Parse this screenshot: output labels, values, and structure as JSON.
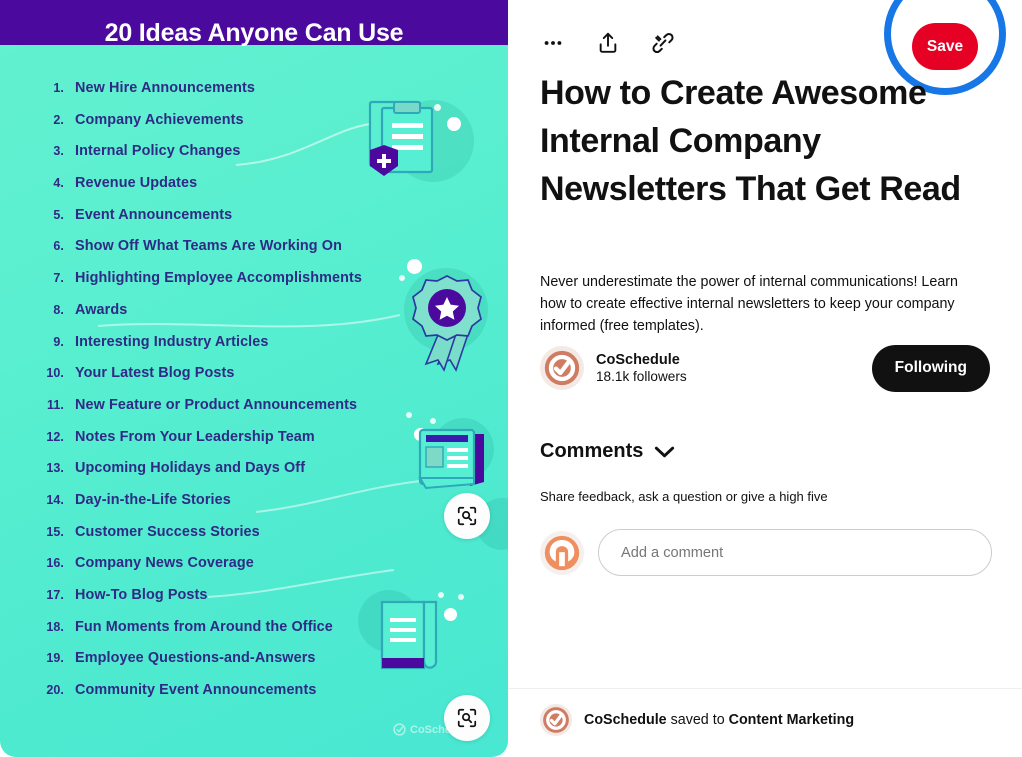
{
  "pin_image": {
    "banner_title": "20 Ideas Anyone Can Use",
    "watermark": "CoSchedule",
    "list": [
      {
        "num": "1.",
        "text": "New Hire Announcements"
      },
      {
        "num": "2.",
        "text": "Company Achievements"
      },
      {
        "num": "3.",
        "text": "Internal Policy Changes"
      },
      {
        "num": "4.",
        "text": "Revenue Updates"
      },
      {
        "num": "5.",
        "text": "Event Announcements"
      },
      {
        "num": "6.",
        "text": "Show Off What Teams Are Working On"
      },
      {
        "num": "7.",
        "text": "Highlighting Employee Accomplishments"
      },
      {
        "num": "8.",
        "text": "Awards"
      },
      {
        "num": "9.",
        "text": "Interesting Industry Articles"
      },
      {
        "num": "10.",
        "text": "Your Latest Blog Posts"
      },
      {
        "num": "11.",
        "text": "New Feature or Product Announcements"
      },
      {
        "num": "12.",
        "text": " Notes From Your Leadership Team"
      },
      {
        "num": "13.",
        "text": "Upcoming Holidays and Days Off"
      },
      {
        "num": "14.",
        "text": "Day-in-the-Life Stories"
      },
      {
        "num": "15.",
        "text": "Customer Success Stories"
      },
      {
        "num": "16.",
        "text": "Company News Coverage"
      },
      {
        "num": "17.",
        "text": "How-To Blog Posts"
      },
      {
        "num": "18.",
        "text": "Fun Moments from Around the Office"
      },
      {
        "num": "19.",
        "text": "Employee Questions-and-Answers"
      },
      {
        "num": "20.",
        "text": "Community Event Announcements"
      }
    ],
    "colors": {
      "banner": "#4b099e",
      "background_top": "#63f0cf",
      "background_bottom": "#49e8d2",
      "list_text": "#2f2a85"
    },
    "lens_buttons": [
      {
        "name": "visual-search-button-middle"
      },
      {
        "name": "visual-search-button-bottom"
      }
    ]
  },
  "detail": {
    "actions": {
      "more_options": "…",
      "share": "share-icon",
      "copy_link": "link-icon"
    },
    "save_label": "Save",
    "save_color": "#e60023",
    "highlight_ring_color": "#1877e6",
    "title": "How to Create Awesome Internal Company Newsletters That Get Read",
    "description": "Never underestimate the power of internal communications! Learn how to create effective internal newsletters to keep your company informed (free templates).",
    "creator": {
      "name": "CoSchedule",
      "followers": "18.1k followers",
      "follow_button_label": "Following"
    },
    "comments": {
      "title": "Comments",
      "subtitle": "Share feedback, ask a question or give a high five",
      "input_placeholder": "Add a comment",
      "input_value": ""
    },
    "saved_to": {
      "user": "CoSchedule",
      "connector": " saved to ",
      "board": "Content Marketing"
    }
  }
}
